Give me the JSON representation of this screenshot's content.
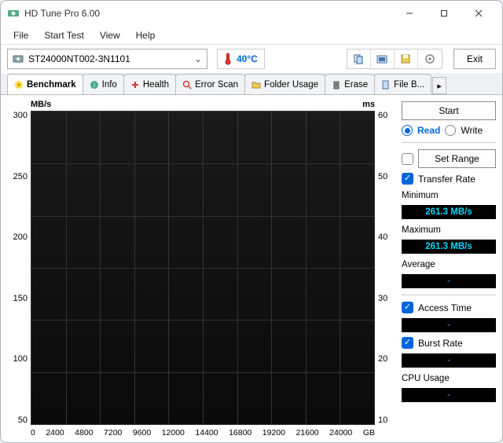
{
  "window": {
    "title": "HD Tune Pro 6.00"
  },
  "menu": {
    "file": "File",
    "start_test": "Start Test",
    "view": "View",
    "help": "Help"
  },
  "toolbar": {
    "drive": "ST24000NT002-3N1101",
    "temperature": "40°C",
    "exit": "Exit"
  },
  "tabs": {
    "benchmark": "Benchmark",
    "info": "Info",
    "health": "Health",
    "error_scan": "Error Scan",
    "folder_usage": "Folder Usage",
    "erase": "Erase",
    "file_b": "File B..."
  },
  "side": {
    "start": "Start",
    "read": "Read",
    "write": "Write",
    "set_range": "Set Range",
    "transfer_rate": "Transfer Rate",
    "minimum_label": "Minimum",
    "minimum_value": "261.3 MB/s",
    "maximum_label": "Maximum",
    "maximum_value": "261.3 MB/s",
    "average_label": "Average",
    "average_value": "-",
    "access_time": "Access Time",
    "access_time_value": "-",
    "burst_rate": "Burst Rate",
    "burst_rate_value": "-",
    "cpu_usage": "CPU Usage",
    "cpu_usage_value": "-"
  },
  "chart_data": {
    "type": "line",
    "title": "",
    "left_axis_label": "MB/s",
    "right_axis_label": "ms",
    "x_unit": "GB",
    "x_ticks": [
      0,
      2400,
      4800,
      7200,
      9600,
      12000,
      14400,
      16800,
      19200,
      21600,
      24000
    ],
    "y_left_ticks": [
      300,
      250,
      200,
      150,
      100,
      50
    ],
    "y_right_ticks": [
      60,
      50,
      40,
      30,
      20,
      10
    ],
    "series": [
      {
        "name": "Transfer Rate",
        "unit": "MB/s",
        "x": [],
        "values": []
      },
      {
        "name": "Access Time",
        "unit": "ms",
        "x": [],
        "values": []
      }
    ],
    "x_range": [
      0,
      24000
    ],
    "y_left_range": [
      0,
      300
    ],
    "y_right_range": [
      0,
      60
    ]
  }
}
